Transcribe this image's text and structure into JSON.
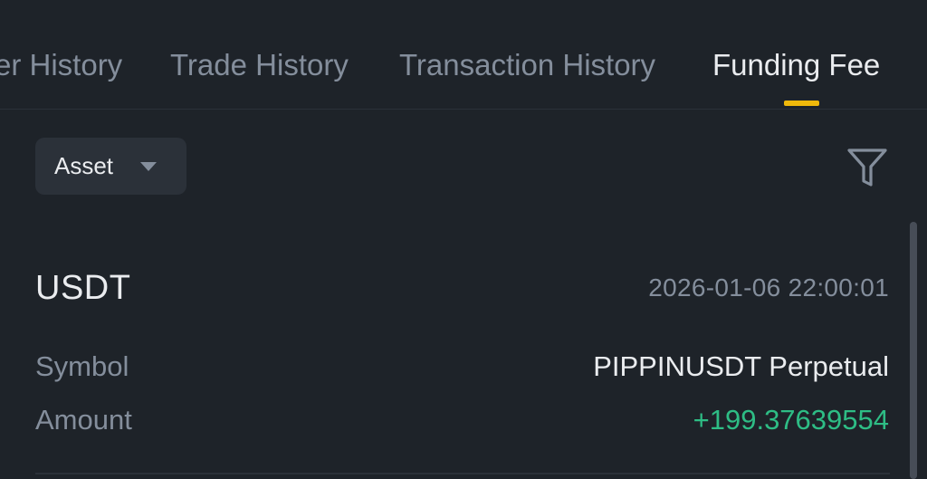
{
  "tabs": [
    {
      "label": "er History",
      "active": false
    },
    {
      "label": "Trade History",
      "active": false
    },
    {
      "label": "Transaction History",
      "active": false
    },
    {
      "label": "Funding Fee",
      "active": true
    }
  ],
  "toolbar": {
    "asset_label": "Asset",
    "asset_icon": "caret-down-icon",
    "filter_icon": "filter-icon"
  },
  "record": {
    "asset": "USDT",
    "time": "2026-01-06 22:00:01",
    "symbol_label": "Symbol",
    "symbol_value": "PIPPINUSDT Perpetual",
    "amount_label": "Amount",
    "amount_value": "+199.37639554"
  },
  "colors": {
    "background": "#1e2329",
    "accent": "#f0b90b",
    "positive": "#2ebd85",
    "muted": "#848e9c",
    "primary_text": "#eaecef"
  }
}
